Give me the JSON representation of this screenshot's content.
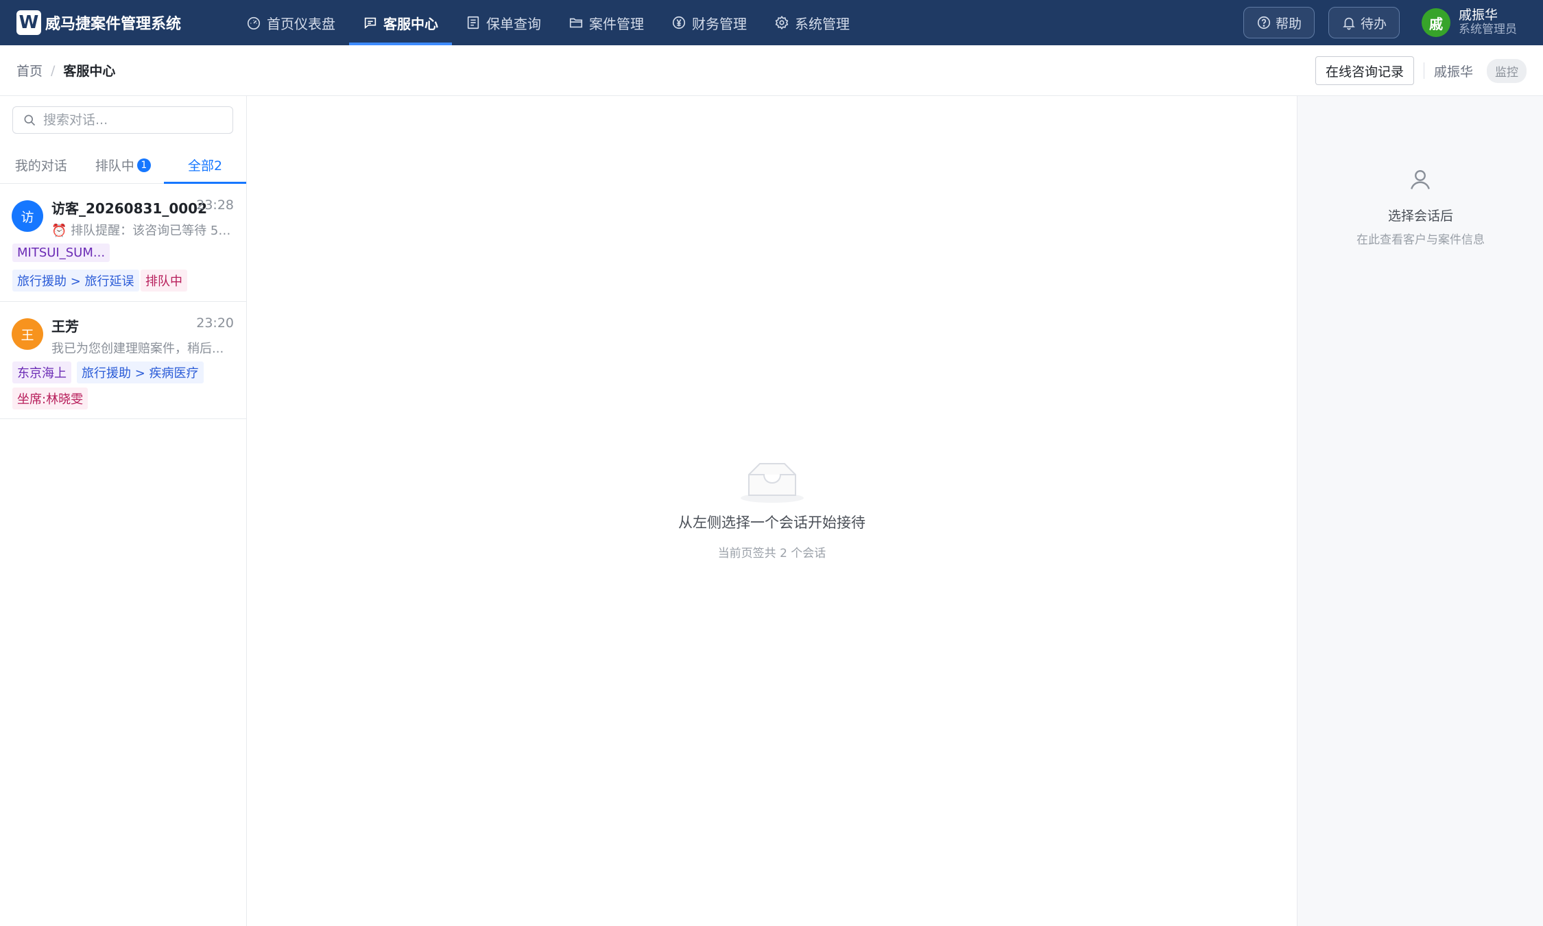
{
  "app": {
    "logo_letter": "W",
    "title": "威马捷案件管理系统"
  },
  "nav": {
    "items": [
      {
        "label": "首页仪表盘",
        "icon": "dashboard-icon"
      },
      {
        "label": "客服中心",
        "icon": "chat-icon",
        "active": true
      },
      {
        "label": "保单查询",
        "icon": "document-list-icon"
      },
      {
        "label": "案件管理",
        "icon": "folder-icon"
      },
      {
        "label": "财务管理",
        "icon": "yen-icon"
      },
      {
        "label": "系统管理",
        "icon": "gear-icon"
      }
    ],
    "help_label": "帮助",
    "todo_label": "待办",
    "accent": "#1f3a64"
  },
  "user": {
    "avatar_char": "戚",
    "name": "戚振华",
    "role": "系统管理员",
    "avatar_color": "#37a42a"
  },
  "breadcrumb": {
    "home": "首页",
    "separator": "/",
    "current": "客服中心"
  },
  "toolbar": {
    "records_button": "在线咨询记录",
    "agent_name": "戚振华",
    "monitor_tag": "监控"
  },
  "sidebar": {
    "search_placeholder": "搜索对话...",
    "tabs": [
      {
        "label": "我的对话"
      },
      {
        "label": "排队中",
        "badge": "1"
      },
      {
        "label": "全部2",
        "active": true
      }
    ],
    "conversations": [
      {
        "avatar_char": "访",
        "avatar_color": "#1677ff",
        "name": "访客_20260831_0002",
        "time": "23:28",
        "preview": "⏰ 排队提醒：该咨询已等待 5 ...",
        "tags": [
          {
            "text": "MITSUI_SUM...",
            "color": "purple"
          },
          {
            "text": "旅行援助 > 旅行延误",
            "color": "blue"
          },
          {
            "text": "排队中",
            "color": "pink"
          }
        ]
      },
      {
        "avatar_char": "王",
        "avatar_color": "#f7931e",
        "name": "王芳",
        "time": "23:20",
        "preview": "我已为您创建理赔案件，稍后...",
        "tags": [
          {
            "text": "东京海上",
            "color": "purple"
          },
          {
            "text": "旅行援助 > 疾病医疗",
            "color": "blue"
          },
          {
            "text": "坐席:林晓雯",
            "color": "pink"
          }
        ]
      }
    ]
  },
  "center": {
    "empty_title": "从左侧选择一个会话开始接待",
    "empty_subtitle": "当前页签共 2 个会话"
  },
  "details": {
    "title": "选择会话后",
    "subtitle": "在此查看客户与案件信息"
  }
}
